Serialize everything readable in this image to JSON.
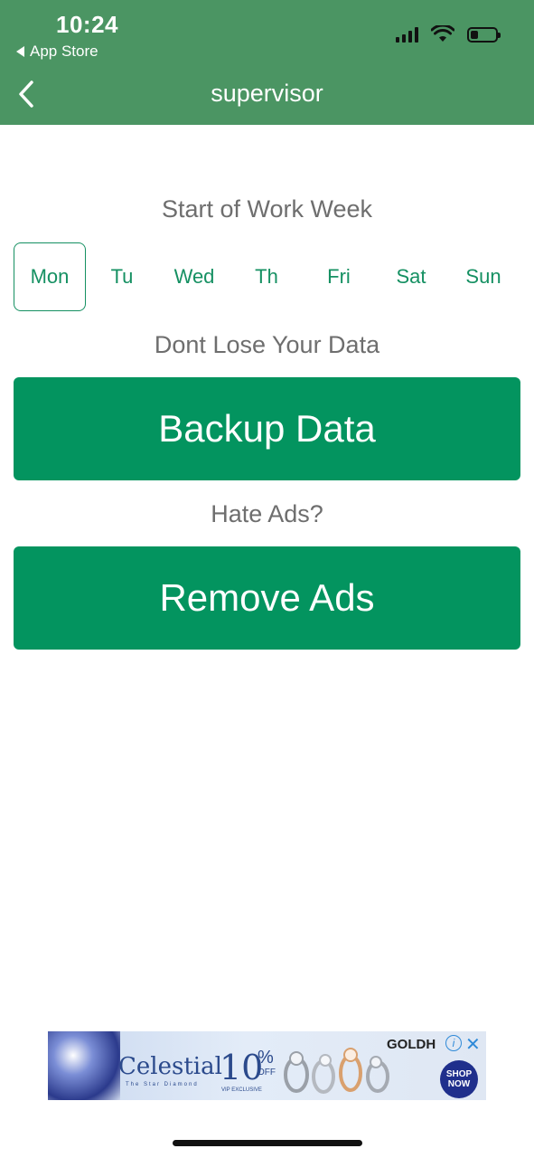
{
  "status_bar": {
    "time": "10:24",
    "back_app": "App Store",
    "signal_bars": 4,
    "battery_level_percent": 30
  },
  "nav": {
    "title": "supervisor"
  },
  "work_week": {
    "label": "Start of Work Week",
    "days": [
      "Mon",
      "Tu",
      "Wed",
      "Th",
      "Fri",
      "Sat",
      "Sun"
    ],
    "selected_day": "Mon"
  },
  "backup": {
    "label": "Dont Lose Your Data",
    "button_label": "Backup Data"
  },
  "ads": {
    "label": "Hate Ads?",
    "button_label": "Remove Ads"
  },
  "ad_banner": {
    "brand": "Celestial",
    "tagline": "The Star Diamond",
    "discount": "10",
    "percent_sign": "%",
    "off": "OFF",
    "exclusive": "VIP EXCLUSIVE",
    "advertiser": "GOLDH",
    "info_glyph": "i",
    "close_glyph": "✕",
    "cta": "SHOP NOW"
  },
  "colors": {
    "header_green": "#4b9563",
    "accent_green": "#159062",
    "button_green": "#03945f"
  }
}
